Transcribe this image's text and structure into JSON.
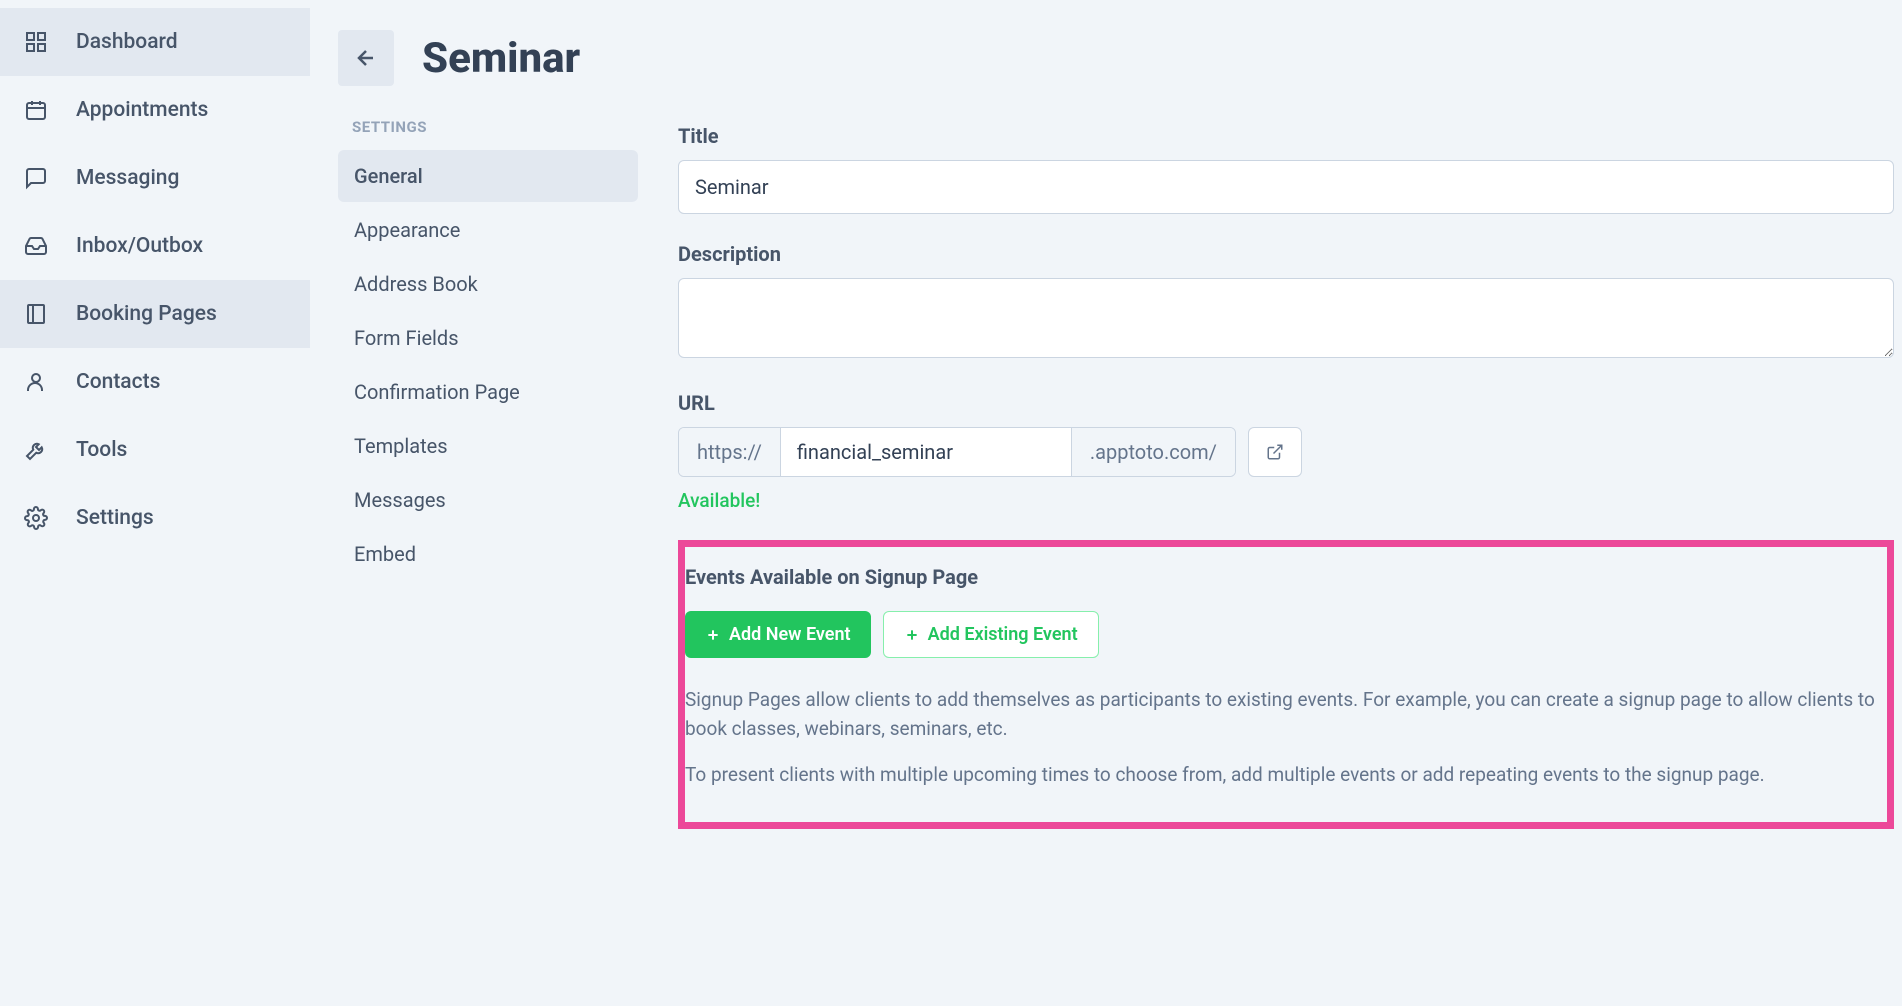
{
  "sidebar": {
    "items": [
      {
        "label": "Dashboard"
      },
      {
        "label": "Appointments"
      },
      {
        "label": "Messaging"
      },
      {
        "label": "Inbox/Outbox"
      },
      {
        "label": "Booking Pages"
      },
      {
        "label": "Contacts"
      },
      {
        "label": "Tools"
      },
      {
        "label": "Settings"
      }
    ]
  },
  "page": {
    "title": "Seminar"
  },
  "subnav": {
    "heading": "SETTINGS",
    "items": [
      {
        "label": "General"
      },
      {
        "label": "Appearance"
      },
      {
        "label": "Address Book"
      },
      {
        "label": "Form Fields"
      },
      {
        "label": "Confirmation Page"
      },
      {
        "label": "Templates"
      },
      {
        "label": "Messages"
      },
      {
        "label": "Embed"
      }
    ]
  },
  "form": {
    "title_label": "Title",
    "title_value": "Seminar",
    "description_label": "Description",
    "description_value": "",
    "url_label": "URL",
    "url_protocol": "https://",
    "url_value": "financial_seminar",
    "url_suffix": ".apptoto.com/",
    "url_status": "Available!",
    "events": {
      "heading": "Events Available on Signup Page",
      "add_new_label": "Add New Event",
      "add_existing_label": "Add Existing Event",
      "help1": "Signup Pages allow clients to add themselves as participants to existing events. For example, you can create a signup page to allow clients to book classes, webinars, seminars, etc.",
      "help2": "To present clients with multiple upcoming times to choose from, add multiple events or add repeating events to the signup page."
    }
  }
}
